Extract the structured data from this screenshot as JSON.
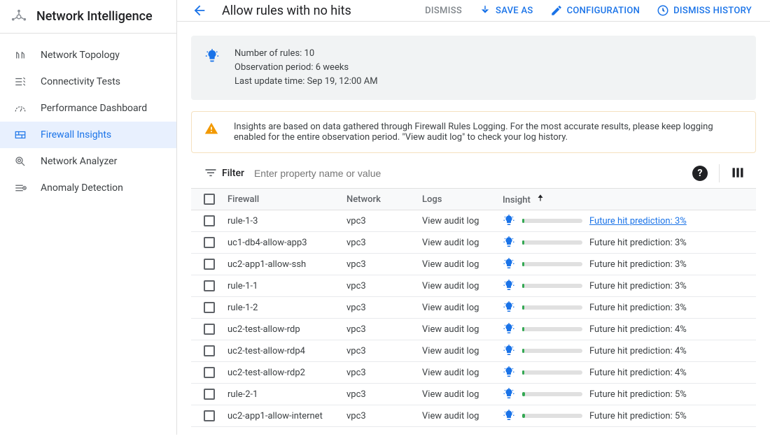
{
  "brand": "Network Intelligence",
  "sidebar": {
    "items": [
      {
        "label": "Network Topology"
      },
      {
        "label": "Connectivity Tests"
      },
      {
        "label": "Performance Dashboard"
      },
      {
        "label": "Firewall Insights"
      },
      {
        "label": "Network Analyzer"
      },
      {
        "label": "Anomaly Detection"
      }
    ]
  },
  "topbar": {
    "title": "Allow rules with no hits",
    "dismiss": "DISMISS",
    "save_as": "SAVE AS",
    "configuration": "CONFIGURATION",
    "dismiss_history": "DISMISS HISTORY"
  },
  "info": {
    "line1": "Number of rules: 10",
    "line2": "Observation period: 6 weeks",
    "line3": "Last update time: Sep 19, 12:00 AM"
  },
  "warning": {
    "text": "Insights are based on data gathered through Firewall Rules Logging. For the most accurate results, please keep logging enabled for the entire observation period. \"View audit log\" to check your log history."
  },
  "filter": {
    "label": "Filter",
    "placeholder": "Enter property name or value"
  },
  "table": {
    "columns": {
      "firewall": "Firewall",
      "network": "Network",
      "logs": "Logs",
      "insight": "Insight"
    },
    "logs_action": "View audit log",
    "prediction_prefix": "Future hit prediction: ",
    "rows": [
      {
        "firewall": "rule-1-3",
        "network": "vpc3",
        "percent": "3%",
        "linked": true
      },
      {
        "firewall": "uc1-db4-allow-app3",
        "network": "vpc3",
        "percent": "3%",
        "linked": false
      },
      {
        "firewall": "uc2-app1-allow-ssh",
        "network": "vpc3",
        "percent": "3%",
        "linked": false
      },
      {
        "firewall": "rule-1-1",
        "network": "vpc3",
        "percent": "3%",
        "linked": false
      },
      {
        "firewall": "rule-1-2",
        "network": "vpc3",
        "percent": "3%",
        "linked": false
      },
      {
        "firewall": "uc2-test-allow-rdp",
        "network": "vpc3",
        "percent": "4%",
        "linked": false
      },
      {
        "firewall": "uc2-test-allow-rdp4",
        "network": "vpc3",
        "percent": "4%",
        "linked": false
      },
      {
        "firewall": "uc2-test-allow-rdp2",
        "network": "vpc3",
        "percent": "4%",
        "linked": false
      },
      {
        "firewall": "rule-2-1",
        "network": "vpc3",
        "percent": "5%",
        "linked": false
      },
      {
        "firewall": "uc2-app1-allow-internet",
        "network": "vpc3",
        "percent": "5%",
        "linked": false
      }
    ]
  }
}
